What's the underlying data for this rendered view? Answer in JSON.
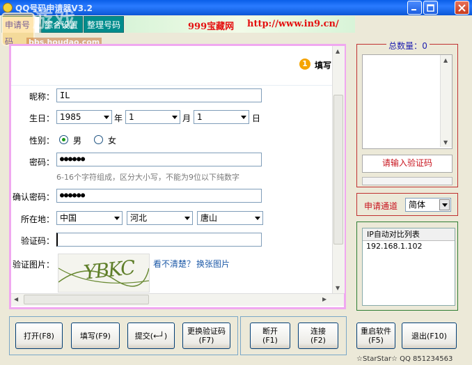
{
  "window": {
    "title": "QQ号码申请器V3.2"
  },
  "watermark": {
    "big_text": "游戏",
    "site": "bbs.houdao.com"
  },
  "tabs": [
    {
      "label": "申请号码"
    },
    {
      "label": "综合设置"
    },
    {
      "label": "整理号码"
    }
  ],
  "banner": {
    "brand": "999宝藏网",
    "url": "http://www.in9.cn/"
  },
  "form": {
    "step_number": "1",
    "step_title": "填写",
    "nickname": {
      "label": "昵称：",
      "value": "IL"
    },
    "birthday": {
      "label": "生日：",
      "year": "1985",
      "year_unit": "年",
      "month": "1",
      "month_unit": "月",
      "day": "1",
      "day_unit": "日"
    },
    "gender": {
      "label": "性别：",
      "male": "男",
      "female": "女",
      "selected": "male"
    },
    "password": {
      "label": "密码：",
      "value": "●●●●●●",
      "hint": "6-16个字符组成，区分大小写，不能为9位以下纯数字"
    },
    "confirm_password": {
      "label": "确认密码：",
      "value": "●●●●●●"
    },
    "location": {
      "label": "所在地：",
      "country": "中国",
      "province": "河北",
      "city": "唐山"
    },
    "captcha": {
      "label": "验证码：",
      "value": ""
    },
    "captcha_image": {
      "label": "验证图片：",
      "text": "YBKC",
      "unclear": "看不清楚？",
      "change": "换张图片"
    }
  },
  "right": {
    "total": {
      "label": "总数量：",
      "value": "0"
    },
    "captcha_prompt": "请输入验证码",
    "channel": {
      "label": "申请通道",
      "value": "简体"
    },
    "ip_list": {
      "header": "IP自动对比列表",
      "items": [
        "192.168.1.102"
      ]
    }
  },
  "buttons": {
    "open": "打开(F8)",
    "fill": "填写(F9)",
    "submit": "提交(←┘)",
    "change_captcha_1": "更换验证码",
    "change_captcha_2": "(F7)",
    "disconnect_1": "断开",
    "disconnect_2": "(F1)",
    "connect_1": "连接",
    "connect_2": "(F2)",
    "restart_1": "重启软件",
    "restart_2": "(F5)",
    "exit": "退出(F10)"
  },
  "footer": {
    "credit": "☆StarStar☆ QQ 851234563"
  },
  "colors": {
    "titlebar": "#0a5ee8",
    "tab_bg": "#008c8c",
    "banner_text": "#e41010",
    "form_border": "#f0a8f0",
    "red_box": "#c03030",
    "green_box": "#2e7d32"
  }
}
